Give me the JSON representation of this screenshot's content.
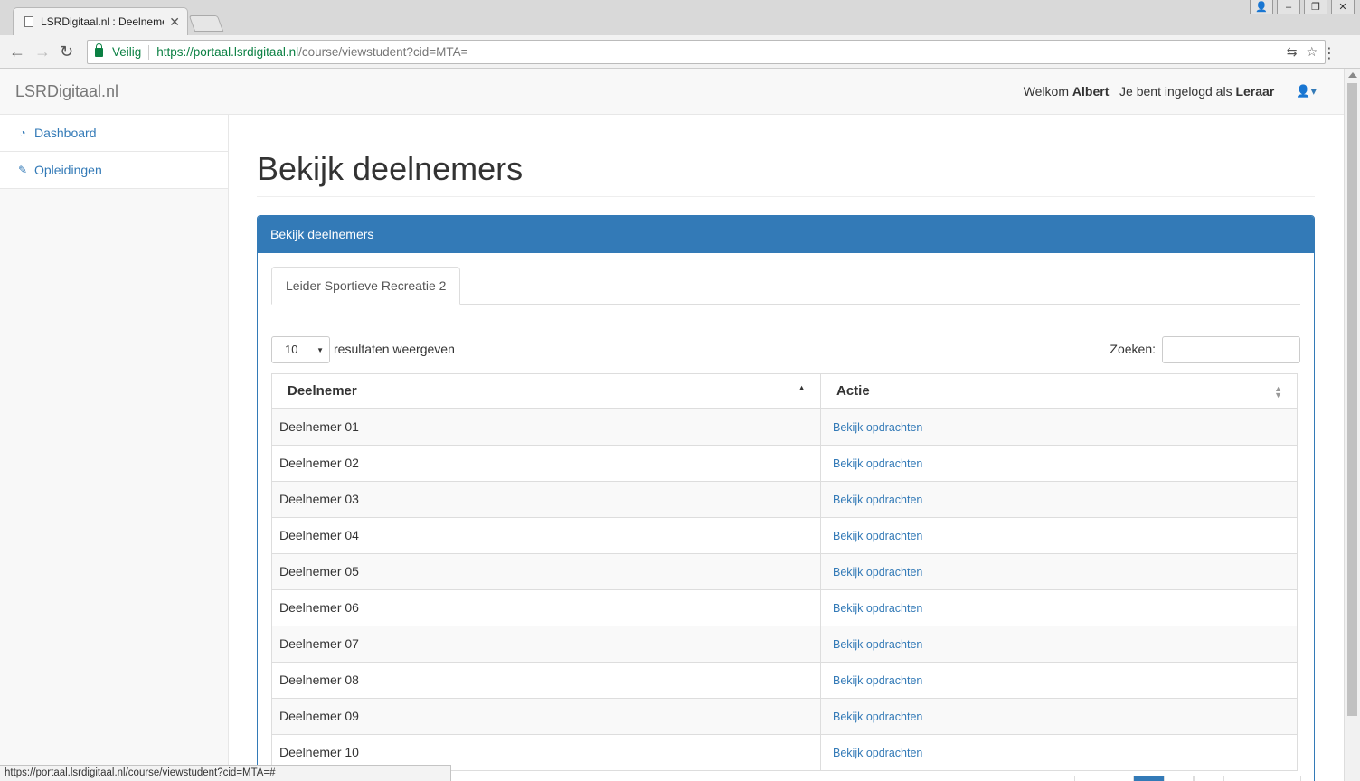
{
  "browser": {
    "tab_title": "LSRDigitaal.nl : Deelnemers",
    "secure_label": "Veilig",
    "url_host": "https://portaal.lsrdigitaal.nl",
    "url_path": "/course/viewstudent?cid=MTA=",
    "status_url": "https://portaal.lsrdigitaal.nl/course/viewstudent?cid=MTA=#"
  },
  "navbar": {
    "brand": "LSRDigitaal.nl",
    "welcome": "Welkom",
    "user_name": "Albert",
    "logged_in_as": "Je bent ingelogd als",
    "role": "Leraar"
  },
  "sidebar": {
    "items": [
      {
        "label": "Dashboard",
        "icon": "dashboard-icon"
      },
      {
        "label": "Opleidingen",
        "icon": "edit-icon"
      }
    ]
  },
  "main": {
    "title": "Bekijk deelnemers",
    "panel_title": "Bekijk deelnemers",
    "tabs": [
      {
        "label": "Leider Sportieve Recreatie 2"
      }
    ],
    "length_value": "10",
    "length_label": "resultaten weergeven",
    "search_label": "Zoeken:",
    "table": {
      "headers": [
        "Deelnemer",
        "Actie"
      ],
      "rows": [
        {
          "name": "Deelnemer 01",
          "action": "Bekijk opdrachten"
        },
        {
          "name": "Deelnemer 02",
          "action": "Bekijk opdrachten"
        },
        {
          "name": "Deelnemer 03",
          "action": "Bekijk opdrachten"
        },
        {
          "name": "Deelnemer 04",
          "action": "Bekijk opdrachten"
        },
        {
          "name": "Deelnemer 05",
          "action": "Bekijk opdrachten"
        },
        {
          "name": "Deelnemer 06",
          "action": "Bekijk opdrachten"
        },
        {
          "name": "Deelnemer 07",
          "action": "Bekijk opdrachten"
        },
        {
          "name": "Deelnemer 08",
          "action": "Bekijk opdrachten"
        },
        {
          "name": "Deelnemer 09",
          "action": "Bekijk opdrachten"
        },
        {
          "name": "Deelnemer 10",
          "action": "Bekijk opdrachten"
        }
      ]
    }
  },
  "colors": {
    "primary": "#337ab7",
    "secure": "#0b8043"
  }
}
